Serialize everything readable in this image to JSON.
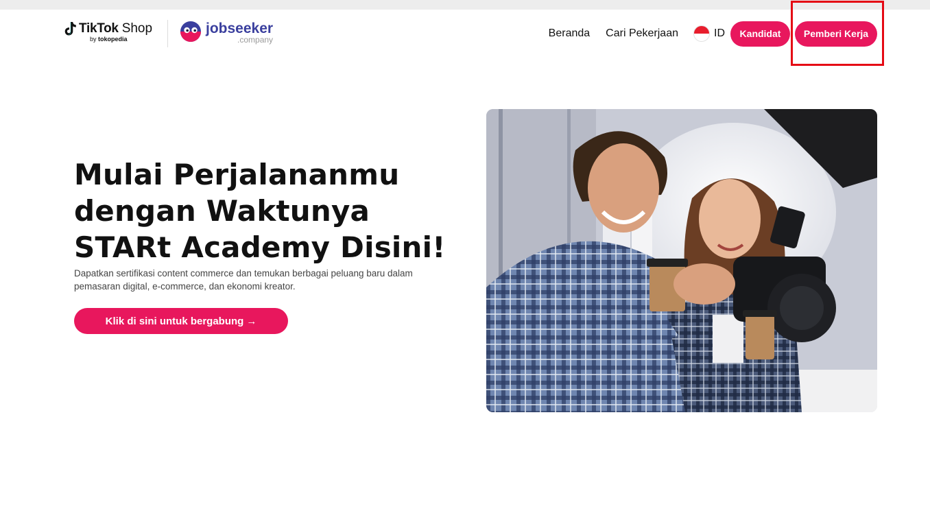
{
  "header": {
    "tiktok_brand": "TikTok",
    "shop_word": "Shop",
    "by_word": "by",
    "tokopedia_word": "tokopedia",
    "jobseeker_brand": "jobseeker",
    "jobseeker_sub": ".company"
  },
  "nav": {
    "home": "Beranda",
    "find_jobs": "Cari Pekerjaan",
    "language": "ID",
    "candidate_button": "Kandidat",
    "employer_button": "Pemberi Kerja"
  },
  "hero": {
    "title_line1": "Mulai Perjalananmu",
    "title_line2": "dengan Waktunya",
    "title_line3": "STARt Academy Disini!",
    "description": "Dapatkan sertifikasi content commerce dan temukan berbagai peluang baru dalam pemasaran digital, e-commerce, dan ekonomi kreator.",
    "cta_label": "Klik di sini untuk bergabung",
    "cta_arrow": "→"
  },
  "colors": {
    "accent": "#e8175d",
    "highlight_box": "#e50914",
    "jobseeker_blue": "#3a3f9e"
  },
  "icons": {
    "tiktok_logo": "tiktok-note-icon",
    "jobseeker_logo": "jobseeker-face-icon",
    "language_flag": "indonesia-flag-icon",
    "cta_arrow": "arrow-right-icon"
  }
}
